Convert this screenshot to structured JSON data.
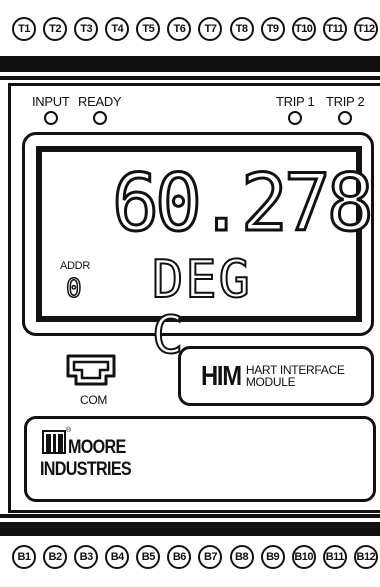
{
  "terminals": {
    "top": [
      "T1",
      "T2",
      "T3",
      "T4",
      "T5",
      "T6",
      "T7",
      "T8",
      "T9",
      "T10",
      "T11",
      "T12"
    ],
    "bottom": [
      "B1",
      "B2",
      "B3",
      "B4",
      "B5",
      "B6",
      "B7",
      "B8",
      "B9",
      "B10",
      "B11",
      "B12"
    ]
  },
  "indicators": {
    "input": "INPUT",
    "ready": "READY",
    "trip1": "TRIP 1",
    "trip2": "TRIP 2"
  },
  "display": {
    "reading": "60.278",
    "unit": "DEG C",
    "addr_label": "ADDR",
    "addr_value": "0"
  },
  "com": {
    "label": "COM"
  },
  "him": {
    "logo": "HIM",
    "line1": "HART INTERFACE",
    "line2": "MODULE"
  },
  "brand": {
    "registered": "®",
    "line1": "MOORE",
    "line2": "INDUSTRIES"
  }
}
